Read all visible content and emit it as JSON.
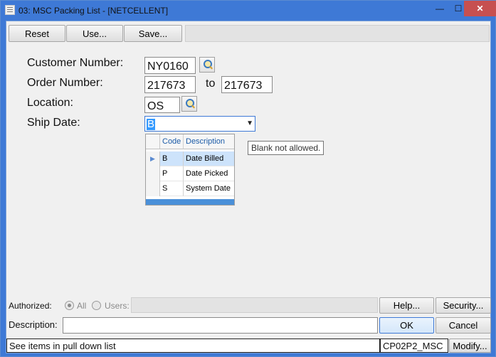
{
  "window": {
    "title": "03: MSC Packing List - [NETCELLENT]",
    "minimize": "—",
    "maximize": "☐",
    "close": "✕"
  },
  "toolbar": {
    "reset_label": "Reset",
    "use_label": "Use...",
    "save_label": "Save..."
  },
  "form": {
    "customer_number": {
      "label": "Customer Number:",
      "value": "NY0160"
    },
    "order_number": {
      "label": "Order Number:",
      "from": "217673",
      "to_label": "to",
      "to": "217673"
    },
    "location": {
      "label": "Location:",
      "value": "OS"
    },
    "ship_date": {
      "label": "Ship Date:",
      "value": "B"
    }
  },
  "ship_date_list": {
    "headers": {
      "code": "Code",
      "description": "Description"
    },
    "rows": [
      {
        "code": "B",
        "description": "Date Billed",
        "selected": true
      },
      {
        "code": "P",
        "description": "Date Picked",
        "selected": false
      },
      {
        "code": "S",
        "description": "System Date",
        "selected": false
      }
    ],
    "current_row_marker": "▶"
  },
  "tooltip": "Blank not allowed.",
  "footer": {
    "authorized_label": "Authorized:",
    "all_label": "All",
    "users_label": "Users:",
    "help_label": "Help...",
    "security_label": "Security...",
    "description_label": "Description:",
    "description_value": "",
    "ok_label": "OK",
    "cancel_label": "Cancel"
  },
  "status": {
    "message": "See items in pull down list",
    "program": "CP02P2_MSC",
    "modify_label": "Modify..."
  },
  "colors": {
    "title_bar": "#3e79d6",
    "close_button": "#c75050",
    "selection": "#3399ff",
    "selected_row": "#cde3fb"
  }
}
